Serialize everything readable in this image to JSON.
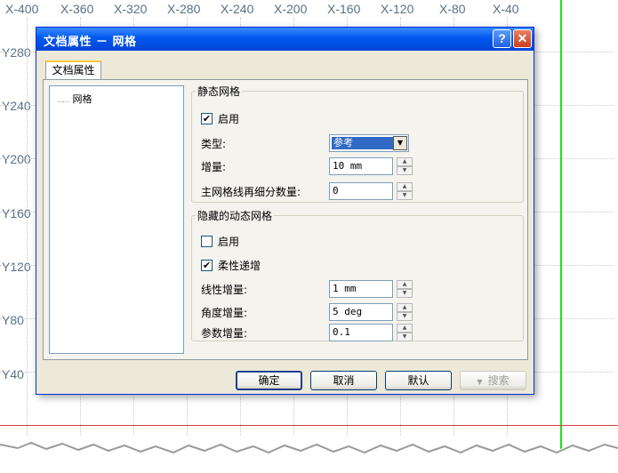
{
  "canvas": {
    "ruler_x": [
      "X-400",
      "X-360",
      "X-320",
      "X-280",
      "X-240",
      "X-200",
      "X-160",
      "X-120",
      "X-80",
      "X-40"
    ],
    "ruler_y": [
      "Y280",
      "Y240",
      "Y200",
      "Y160",
      "Y120",
      "Y80",
      "Y40"
    ]
  },
  "dialog": {
    "title": "文档属性 － 网格",
    "help_glyph": "?",
    "close_glyph": "✕",
    "tab_label": "文档属性",
    "tree_item": "网格",
    "static_grid": {
      "legend": "静态网格",
      "enable_label": "启用",
      "enable_checked": true,
      "type_label": "类型:",
      "type_value": "参考",
      "increment_label": "增量:",
      "increment_value": "10 mm",
      "subdiv_label": "主网格线再细分数量:",
      "subdiv_value": "0"
    },
    "dynamic_grid": {
      "legend": "隐藏的动态网格",
      "enable_label": "启用",
      "enable_checked": false,
      "flex_label": "柔性递增",
      "flex_checked": true,
      "linear_label": "线性增量:",
      "linear_value": "1 mm",
      "angle_label": "角度增量:",
      "angle_value": "5 deg",
      "param_label": "参数增量:",
      "param_value": "0.1"
    },
    "buttons": {
      "ok": "确定",
      "cancel": "取消",
      "default": "默认",
      "search": "搜索"
    }
  }
}
